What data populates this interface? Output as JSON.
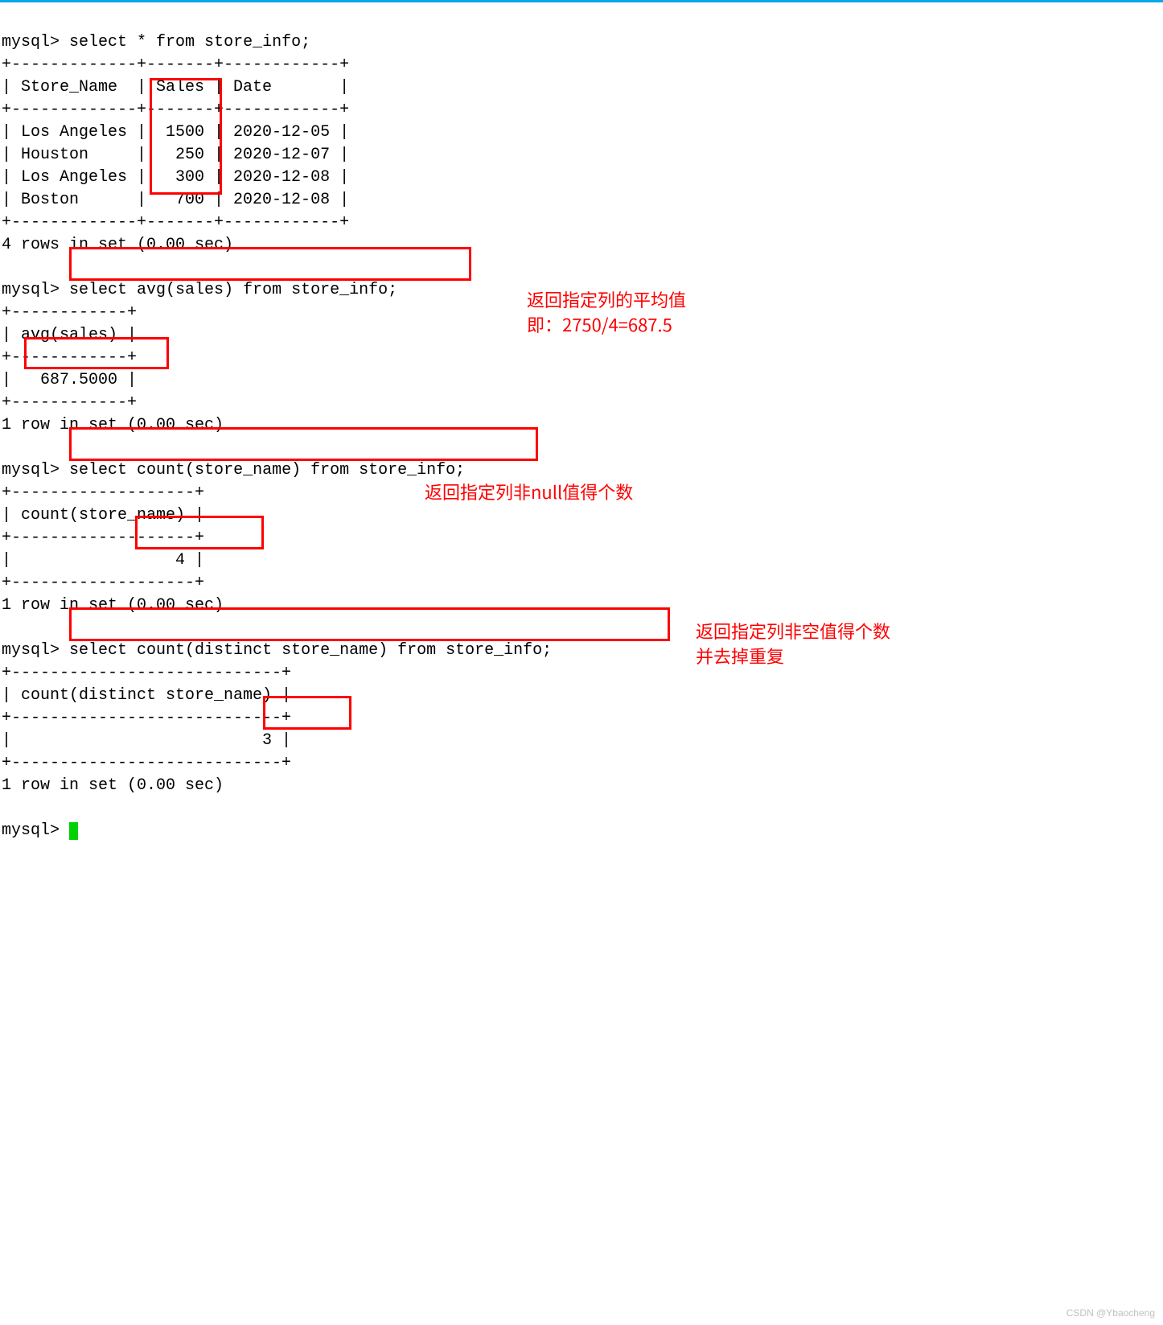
{
  "prompt": "mysql>",
  "queries": {
    "q1": "select * from store_info;",
    "q2": "select avg(sales) from store_info;",
    "q3": "select count(store_name) from store_info;",
    "q4": "select count(distinct store_name) from store_info;"
  },
  "table1": {
    "sep_top": "+-------------+-------+------------+",
    "header": "| Store_Name  | Sales | Date       |",
    "sep_mid": "+-------------+-------+------------+",
    "rows": [
      "| Los Angeles |  1500 | 2020-12-05 |",
      "| Houston     |   250 | 2020-12-07 |",
      "| Los Angeles |   300 | 2020-12-08 |",
      "| Boston      |   700 | 2020-12-08 |"
    ],
    "sep_bot": "+-------------+-------+------------+",
    "footer": "4 rows in set (0.00 sec)"
  },
  "table2": {
    "sep_top": "+------------+",
    "header": "| avg(sales) |",
    "sep_mid": "+------------+",
    "row": "|   687.5000 |",
    "sep_bot": "+------------+",
    "footer": "1 row in set (0.00 sec)"
  },
  "table3": {
    "sep_top": "+-------------------+",
    "header": "| count(store_name) |",
    "sep_mid": "+-------------------+",
    "row": "|                 4 |",
    "sep_bot": "+-------------------+",
    "footer": "1 row in set (0.00 sec)"
  },
  "table4": {
    "sep_top": "+----------------------------+",
    "header": "| count(distinct store_name) |",
    "sep_mid": "+----------------------------+",
    "row": "|                          3 |",
    "sep_bot": "+----------------------------+",
    "footer": "1 row in set (0.00 sec)"
  },
  "annotations": {
    "avg_note_l1": "返回指定列的平均值",
    "avg_note_l2": "即：2750/4=687.5",
    "count_note": "返回指定列非null值得个数",
    "distinct_note_l1": "返回指定列非空值得个数",
    "distinct_note_l2": "并去掉重复"
  },
  "watermark": "CSDN @Ybaocheng",
  "chart_data": {
    "type": "table",
    "columns": [
      "Store_Name",
      "Sales",
      "Date"
    ],
    "rows": [
      [
        "Los Angeles",
        1500,
        "2020-12-05"
      ],
      [
        "Houston",
        250,
        "2020-12-07"
      ],
      [
        "Los Angeles",
        300,
        "2020-12-08"
      ],
      [
        "Boston",
        700,
        "2020-12-08"
      ]
    ],
    "aggregates": {
      "avg_sales": 687.5,
      "count_store_name": 4,
      "count_distinct_store_name": 3
    }
  }
}
